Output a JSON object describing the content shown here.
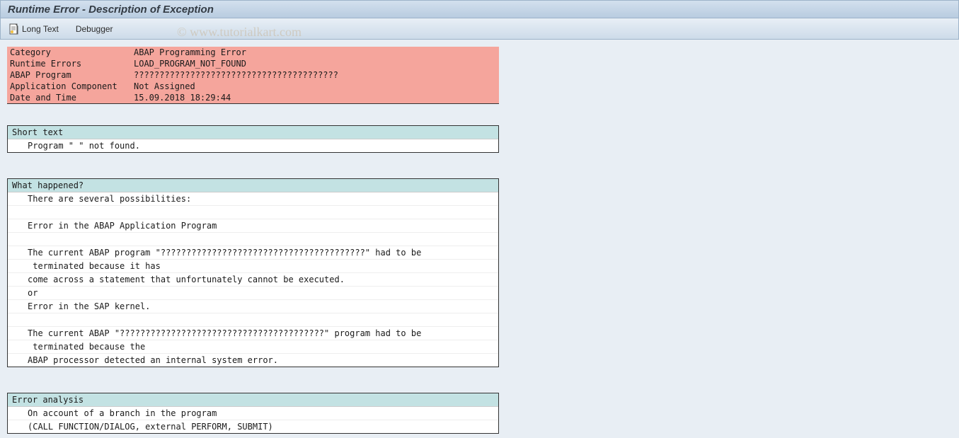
{
  "title": "Runtime Error - Description of Exception",
  "toolbar": {
    "long_text_label": "Long Text",
    "debugger_label": "Debugger"
  },
  "watermark": "© www.tutorialkart.com",
  "info": {
    "rows": [
      {
        "label": "Category",
        "value": "ABAP Programming Error"
      },
      {
        "label": "Runtime Errors",
        "value": "LOAD_PROGRAM_NOT_FOUND"
      },
      {
        "label": "ABAP Program",
        "value": "????????????????????????????????????????"
      },
      {
        "label": "Application Component",
        "value": "Not Assigned"
      },
      {
        "label": "Date and Time",
        "value": "15.09.2018 18:29:44"
      }
    ]
  },
  "sections": [
    {
      "header": "Short text",
      "lines": [
        "Program \" \" not found."
      ]
    },
    {
      "header": "What happened?",
      "lines": [
        "There are several possibilities:",
        "",
        "Error in the ABAP Application Program",
        "",
        "The current ABAP program \"????????????????????????????????????????\" had to be",
        " terminated because it has",
        "come across a statement that unfortunately cannot be executed.",
        "or",
        "Error in the SAP kernel.",
        "",
        "The current ABAP \"????????????????????????????????????????\" program had to be",
        " terminated because the",
        "ABAP processor detected an internal system error."
      ]
    },
    {
      "header": "Error analysis",
      "lines": [
        "On account of a branch in the program",
        "(CALL FUNCTION/DIALOG, external PERFORM, SUBMIT)"
      ]
    }
  ]
}
